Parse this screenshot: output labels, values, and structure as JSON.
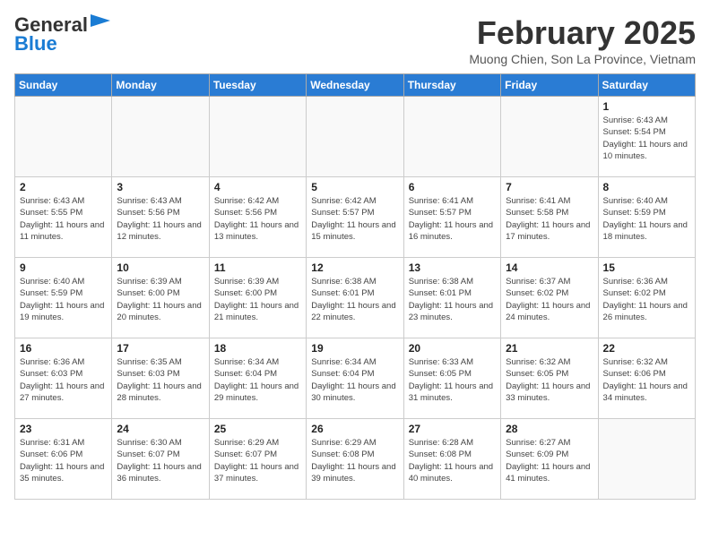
{
  "header": {
    "logo_general": "General",
    "logo_blue": "Blue",
    "month_year": "February 2025",
    "location": "Muong Chien, Son La Province, Vietnam"
  },
  "weekdays": [
    "Sunday",
    "Monday",
    "Tuesday",
    "Wednesday",
    "Thursday",
    "Friday",
    "Saturday"
  ],
  "weeks": [
    [
      {
        "day": "",
        "info": ""
      },
      {
        "day": "",
        "info": ""
      },
      {
        "day": "",
        "info": ""
      },
      {
        "day": "",
        "info": ""
      },
      {
        "day": "",
        "info": ""
      },
      {
        "day": "",
        "info": ""
      },
      {
        "day": "1",
        "info": "Sunrise: 6:43 AM\nSunset: 5:54 PM\nDaylight: 11 hours and 10 minutes."
      }
    ],
    [
      {
        "day": "2",
        "info": "Sunrise: 6:43 AM\nSunset: 5:55 PM\nDaylight: 11 hours and 11 minutes."
      },
      {
        "day": "3",
        "info": "Sunrise: 6:43 AM\nSunset: 5:56 PM\nDaylight: 11 hours and 12 minutes."
      },
      {
        "day": "4",
        "info": "Sunrise: 6:42 AM\nSunset: 5:56 PM\nDaylight: 11 hours and 13 minutes."
      },
      {
        "day": "5",
        "info": "Sunrise: 6:42 AM\nSunset: 5:57 PM\nDaylight: 11 hours and 15 minutes."
      },
      {
        "day": "6",
        "info": "Sunrise: 6:41 AM\nSunset: 5:57 PM\nDaylight: 11 hours and 16 minutes."
      },
      {
        "day": "7",
        "info": "Sunrise: 6:41 AM\nSunset: 5:58 PM\nDaylight: 11 hours and 17 minutes."
      },
      {
        "day": "8",
        "info": "Sunrise: 6:40 AM\nSunset: 5:59 PM\nDaylight: 11 hours and 18 minutes."
      }
    ],
    [
      {
        "day": "9",
        "info": "Sunrise: 6:40 AM\nSunset: 5:59 PM\nDaylight: 11 hours and 19 minutes."
      },
      {
        "day": "10",
        "info": "Sunrise: 6:39 AM\nSunset: 6:00 PM\nDaylight: 11 hours and 20 minutes."
      },
      {
        "day": "11",
        "info": "Sunrise: 6:39 AM\nSunset: 6:00 PM\nDaylight: 11 hours and 21 minutes."
      },
      {
        "day": "12",
        "info": "Sunrise: 6:38 AM\nSunset: 6:01 PM\nDaylight: 11 hours and 22 minutes."
      },
      {
        "day": "13",
        "info": "Sunrise: 6:38 AM\nSunset: 6:01 PM\nDaylight: 11 hours and 23 minutes."
      },
      {
        "day": "14",
        "info": "Sunrise: 6:37 AM\nSunset: 6:02 PM\nDaylight: 11 hours and 24 minutes."
      },
      {
        "day": "15",
        "info": "Sunrise: 6:36 AM\nSunset: 6:02 PM\nDaylight: 11 hours and 26 minutes."
      }
    ],
    [
      {
        "day": "16",
        "info": "Sunrise: 6:36 AM\nSunset: 6:03 PM\nDaylight: 11 hours and 27 minutes."
      },
      {
        "day": "17",
        "info": "Sunrise: 6:35 AM\nSunset: 6:03 PM\nDaylight: 11 hours and 28 minutes."
      },
      {
        "day": "18",
        "info": "Sunrise: 6:34 AM\nSunset: 6:04 PM\nDaylight: 11 hours and 29 minutes."
      },
      {
        "day": "19",
        "info": "Sunrise: 6:34 AM\nSunset: 6:04 PM\nDaylight: 11 hours and 30 minutes."
      },
      {
        "day": "20",
        "info": "Sunrise: 6:33 AM\nSunset: 6:05 PM\nDaylight: 11 hours and 31 minutes."
      },
      {
        "day": "21",
        "info": "Sunrise: 6:32 AM\nSunset: 6:05 PM\nDaylight: 11 hours and 33 minutes."
      },
      {
        "day": "22",
        "info": "Sunrise: 6:32 AM\nSunset: 6:06 PM\nDaylight: 11 hours and 34 minutes."
      }
    ],
    [
      {
        "day": "23",
        "info": "Sunrise: 6:31 AM\nSunset: 6:06 PM\nDaylight: 11 hours and 35 minutes."
      },
      {
        "day": "24",
        "info": "Sunrise: 6:30 AM\nSunset: 6:07 PM\nDaylight: 11 hours and 36 minutes."
      },
      {
        "day": "25",
        "info": "Sunrise: 6:29 AM\nSunset: 6:07 PM\nDaylight: 11 hours and 37 minutes."
      },
      {
        "day": "26",
        "info": "Sunrise: 6:29 AM\nSunset: 6:08 PM\nDaylight: 11 hours and 39 minutes."
      },
      {
        "day": "27",
        "info": "Sunrise: 6:28 AM\nSunset: 6:08 PM\nDaylight: 11 hours and 40 minutes."
      },
      {
        "day": "28",
        "info": "Sunrise: 6:27 AM\nSunset: 6:09 PM\nDaylight: 11 hours and 41 minutes."
      },
      {
        "day": "",
        "info": ""
      }
    ]
  ]
}
